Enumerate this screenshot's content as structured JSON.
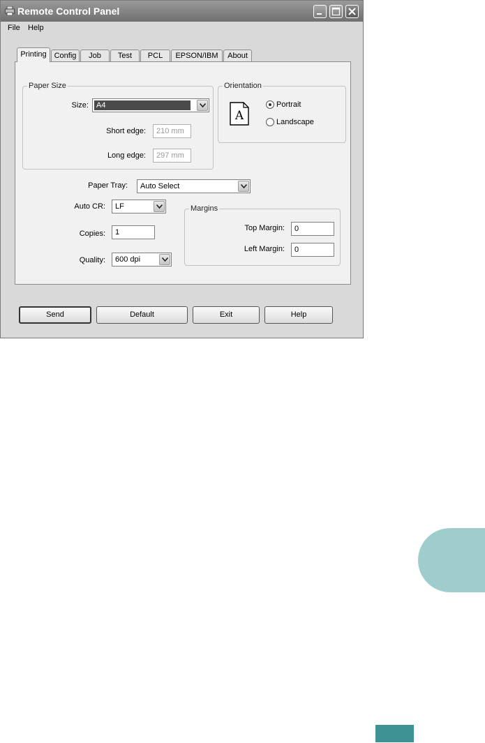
{
  "window": {
    "title": "Remote Control Panel",
    "icon": "printer-icon",
    "controls": [
      "minimize-icon",
      "maximize-icon",
      "close-icon"
    ]
  },
  "menu": {
    "file": "File",
    "help": "Help"
  },
  "tabs": [
    {
      "label": "Printing",
      "active": true
    },
    {
      "label": "Config"
    },
    {
      "label": "Job"
    },
    {
      "label": "Test"
    },
    {
      "label": "PCL"
    },
    {
      "label": "EPSON/IBM"
    },
    {
      "label": "About"
    }
  ],
  "paper_size": {
    "group_label": "Paper Size",
    "size_label": "Size:",
    "size_value": "A4",
    "short_edge_label": "Short edge:",
    "short_edge_value": "210 mm",
    "long_edge_label": "Long edge:",
    "long_edge_value": "297 mm"
  },
  "orientation": {
    "group_label": "Orientation",
    "portrait": "Portrait",
    "landscape": "Landscape",
    "selected": "Portrait",
    "preview_glyph": "A"
  },
  "paper_tray": {
    "label": "Paper Tray:",
    "value": "Auto Select"
  },
  "auto_cr": {
    "label": "Auto CR:",
    "value": "LF"
  },
  "copies": {
    "label": "Copies:",
    "value": "1"
  },
  "quality": {
    "label": "Quality:",
    "value": "600 dpi"
  },
  "margins": {
    "group_label": "Margins",
    "top_label": "Top Margin:",
    "top_value": "0",
    "left_label": "Left Margin:",
    "left_value": "0"
  },
  "buttons": {
    "send": "Send",
    "default": "Default",
    "exit": "Exit",
    "help": "Help"
  },
  "colors": {
    "side_tab": "#9ecdcc",
    "footer_block": "#3d9393"
  }
}
